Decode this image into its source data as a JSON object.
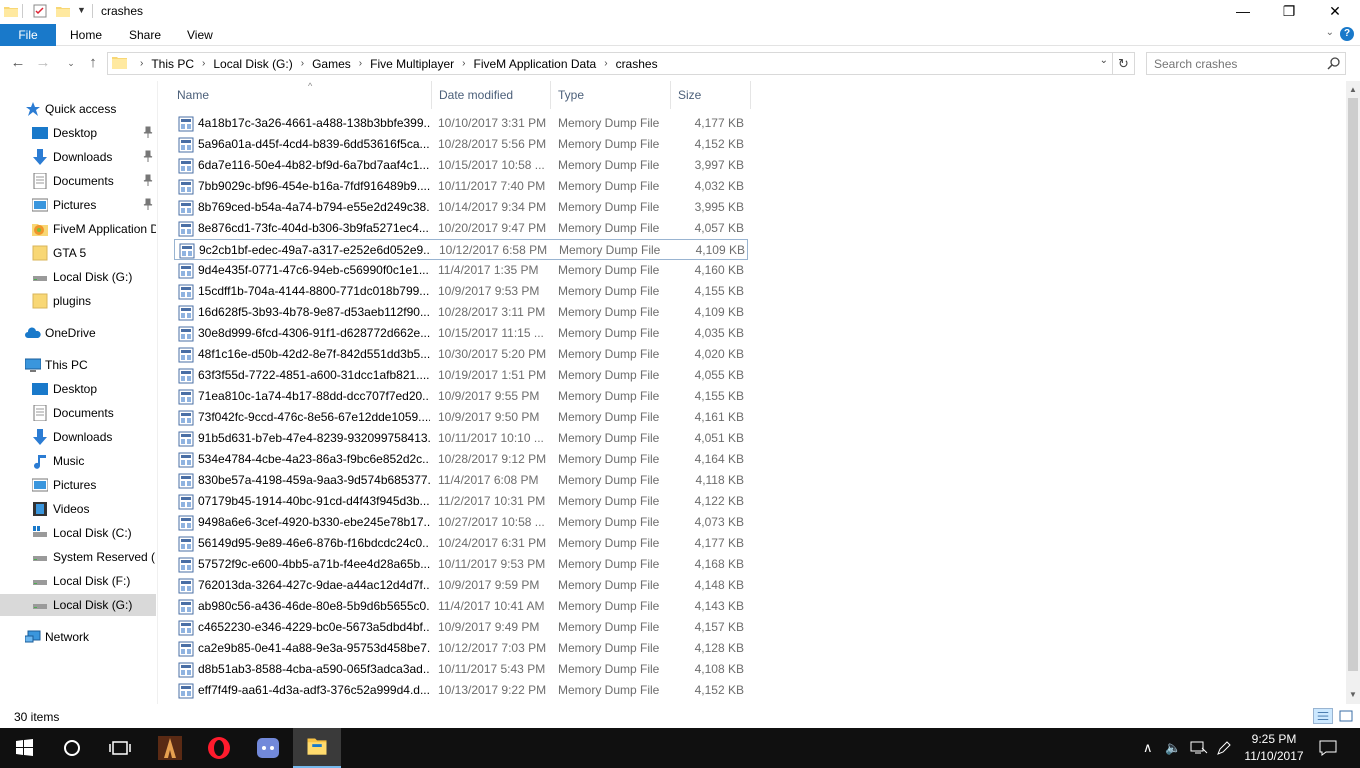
{
  "window": {
    "title": "crashes",
    "controls": {
      "minimize": "—",
      "maximize": "❐",
      "close": "✕"
    }
  },
  "ribbon": {
    "file": "File",
    "tabs": [
      "Home",
      "Share",
      "View"
    ]
  },
  "address": {
    "crumbs": [
      "This PC",
      "Local Disk (G:)",
      "Games",
      "Five Multiplayer",
      "FiveM Application Data",
      "crashes"
    ]
  },
  "search": {
    "placeholder": "Search crashes"
  },
  "sidebar": {
    "quick_access": "Quick access",
    "quick_items": [
      "Desktop",
      "Downloads",
      "Documents",
      "Pictures",
      "FiveM Application D",
      "GTA 5",
      "Local Disk (G:)",
      "plugins"
    ],
    "onedrive": "OneDrive",
    "this_pc": "This PC",
    "pc_items": [
      "Desktop",
      "Documents",
      "Downloads",
      "Music",
      "Pictures",
      "Videos",
      "Local Disk (C:)",
      "System Reserved (E:",
      "Local Disk (F:)",
      "Local Disk (G:)"
    ],
    "network": "Network"
  },
  "columns": {
    "name": "Name",
    "date": "Date modified",
    "type": "Type",
    "size": "Size"
  },
  "files": [
    {
      "name": "4a18b17c-3a26-4661-a488-138b3bbfe399....",
      "date": "10/10/2017 3:31 PM",
      "type": "Memory Dump File",
      "size": "4,177 KB"
    },
    {
      "name": "5a96a01a-d45f-4cd4-b839-6dd53616f5ca....",
      "date": "10/28/2017 5:56 PM",
      "type": "Memory Dump File",
      "size": "4,152 KB"
    },
    {
      "name": "6da7e116-50e4-4b82-bf9d-6a7bd7aaf4c1....",
      "date": "10/15/2017 10:58 ...",
      "type": "Memory Dump File",
      "size": "3,997 KB"
    },
    {
      "name": "7bb9029c-bf96-454e-b16a-7fdf916489b9....",
      "date": "10/11/2017 7:40 PM",
      "type": "Memory Dump File",
      "size": "4,032 KB"
    },
    {
      "name": "8b769ced-b54a-4a74-b794-e55e2d249c38....",
      "date": "10/14/2017 9:34 PM",
      "type": "Memory Dump File",
      "size": "3,995 KB"
    },
    {
      "name": "8e876cd1-73fc-404d-b306-3b9fa5271ec4....",
      "date": "10/20/2017 9:47 PM",
      "type": "Memory Dump File",
      "size": "4,057 KB"
    },
    {
      "name": "9c2cb1bf-edec-49a7-a317-e252e6d052e9....",
      "date": "10/12/2017 6:58 PM",
      "type": "Memory Dump File",
      "size": "4,109 KB"
    },
    {
      "name": "9d4e435f-0771-47c6-94eb-c56990f0c1e1....",
      "date": "11/4/2017 1:35 PM",
      "type": "Memory Dump File",
      "size": "4,160 KB"
    },
    {
      "name": "15cdff1b-704a-4144-8800-771dc018b799....",
      "date": "10/9/2017 9:53 PM",
      "type": "Memory Dump File",
      "size": "4,155 KB"
    },
    {
      "name": "16d628f5-3b93-4b78-9e87-d53aeb112f90....",
      "date": "10/28/2017 3:11 PM",
      "type": "Memory Dump File",
      "size": "4,109 KB"
    },
    {
      "name": "30e8d999-6fcd-4306-91f1-d628772d662e....",
      "date": "10/15/2017 11:15 ...",
      "type": "Memory Dump File",
      "size": "4,035 KB"
    },
    {
      "name": "48f1c16e-d50b-42d2-8e7f-842d551dd3b5....",
      "date": "10/30/2017 5:20 PM",
      "type": "Memory Dump File",
      "size": "4,020 KB"
    },
    {
      "name": "63f3f55d-7722-4851-a600-31dcc1afb821....",
      "date": "10/19/2017 1:51 PM",
      "type": "Memory Dump File",
      "size": "4,055 KB"
    },
    {
      "name": "71ea810c-1a74-4b17-88dd-dcc707f7ed20....",
      "date": "10/9/2017 9:55 PM",
      "type": "Memory Dump File",
      "size": "4,155 KB"
    },
    {
      "name": "73f042fc-9ccd-476c-8e56-67e12dde1059....",
      "date": "10/9/2017 9:50 PM",
      "type": "Memory Dump File",
      "size": "4,161 KB"
    },
    {
      "name": "91b5d631-b7eb-47e4-8239-932099758413....",
      "date": "10/11/2017 10:10 ...",
      "type": "Memory Dump File",
      "size": "4,051 KB"
    },
    {
      "name": "534e4784-4cbe-4a23-86a3-f9bc6e852d2c....",
      "date": "10/28/2017 9:12 PM",
      "type": "Memory Dump File",
      "size": "4,164 KB"
    },
    {
      "name": "830be57a-4198-459a-9aa3-9d574b685377....",
      "date": "11/4/2017 6:08 PM",
      "type": "Memory Dump File",
      "size": "4,118 KB"
    },
    {
      "name": "07179b45-1914-40bc-91cd-d4f43f945d3b....",
      "date": "11/2/2017 10:31 PM",
      "type": "Memory Dump File",
      "size": "4,122 KB"
    },
    {
      "name": "9498a6e6-3cef-4920-b330-ebe245e78b17....",
      "date": "10/27/2017 10:58 ...",
      "type": "Memory Dump File",
      "size": "4,073 KB"
    },
    {
      "name": "56149d95-9e89-46e6-876b-f16bdcdc24c0....",
      "date": "10/24/2017 6:31 PM",
      "type": "Memory Dump File",
      "size": "4,177 KB"
    },
    {
      "name": "57572f9c-e600-4bb5-a71b-f4ee4d28a65b....",
      "date": "10/11/2017 9:53 PM",
      "type": "Memory Dump File",
      "size": "4,168 KB"
    },
    {
      "name": "762013da-3264-427c-9dae-a44ac12d4d7f....",
      "date": "10/9/2017 9:59 PM",
      "type": "Memory Dump File",
      "size": "4,148 KB"
    },
    {
      "name": "ab980c56-a436-46de-80e8-5b9d6b5655c0....",
      "date": "11/4/2017 10:41 AM",
      "type": "Memory Dump File",
      "size": "4,143 KB"
    },
    {
      "name": "c4652230-e346-4229-bc0e-5673a5dbd4bf....",
      "date": "10/9/2017 9:49 PM",
      "type": "Memory Dump File",
      "size": "4,157 KB"
    },
    {
      "name": "ca2e9b85-0e41-4a88-9e3a-95753d458be7....",
      "date": "10/12/2017 7:03 PM",
      "type": "Memory Dump File",
      "size": "4,128 KB"
    },
    {
      "name": "d8b51ab3-8588-4cba-a590-065f3adca3ad....",
      "date": "10/11/2017 5:43 PM",
      "type": "Memory Dump File",
      "size": "4,108 KB"
    },
    {
      "name": "eff7f4f9-aa61-4d3a-adf3-376c52a999d4.d...",
      "date": "10/13/2017 9:22 PM",
      "type": "Memory Dump File",
      "size": "4,152 KB"
    }
  ],
  "status": {
    "count": "30 items"
  },
  "taskbar": {
    "apps": [
      "windows-start",
      "cortana",
      "task-view",
      "game-app",
      "opera",
      "discord",
      "file-explorer"
    ],
    "time": "9:25 PM",
    "date": "11/10/2017"
  },
  "colors": {
    "accent": "#1979ca",
    "selection": "#cce8ff",
    "taskbar": "#101010"
  }
}
